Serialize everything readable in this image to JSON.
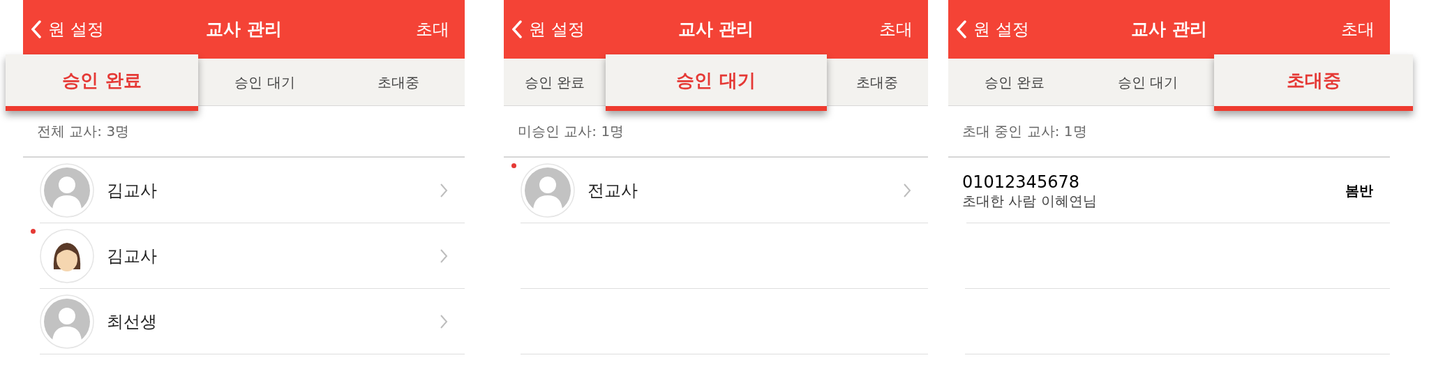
{
  "screens": [
    {
      "nav": {
        "back": "원 설정",
        "title": "교사 관리",
        "action": "초대"
      },
      "tabs": [
        {
          "label": "승인 완료",
          "selected": true
        },
        {
          "label": "승인 대기",
          "selected": false
        },
        {
          "label": "초대중",
          "selected": false
        }
      ],
      "summary": "전체 교사: 3명",
      "items": [
        {
          "kind": "teacher",
          "photo": false,
          "new": false,
          "name": "김교사"
        },
        {
          "kind": "teacher",
          "photo": true,
          "new": true,
          "name": "김교사"
        },
        {
          "kind": "teacher",
          "photo": false,
          "new": false,
          "name": "최선생"
        }
      ]
    },
    {
      "nav": {
        "back": "원 설정",
        "title": "교사 관리",
        "action": "초대"
      },
      "tabs": [
        {
          "label": "승인 완료",
          "selected": false
        },
        {
          "label": "승인 대기",
          "selected": true
        },
        {
          "label": "초대중",
          "selected": false
        }
      ],
      "summary": "미승인 교사: 1명",
      "items": [
        {
          "kind": "teacher",
          "photo": false,
          "new": true,
          "name": "전교사"
        }
      ]
    },
    {
      "nav": {
        "back": "원 설정",
        "title": "교사 관리",
        "action": "초대"
      },
      "tabs": [
        {
          "label": "승인 완료",
          "selected": false
        },
        {
          "label": "승인 대기",
          "selected": false
        },
        {
          "label": "초대중",
          "selected": true
        }
      ],
      "summary": "초대 중인 교사: 1명",
      "items": [
        {
          "kind": "invite",
          "phone": "01012345678",
          "inviter": "초대한 사람 이혜연님",
          "class": "봄반"
        }
      ]
    }
  ]
}
